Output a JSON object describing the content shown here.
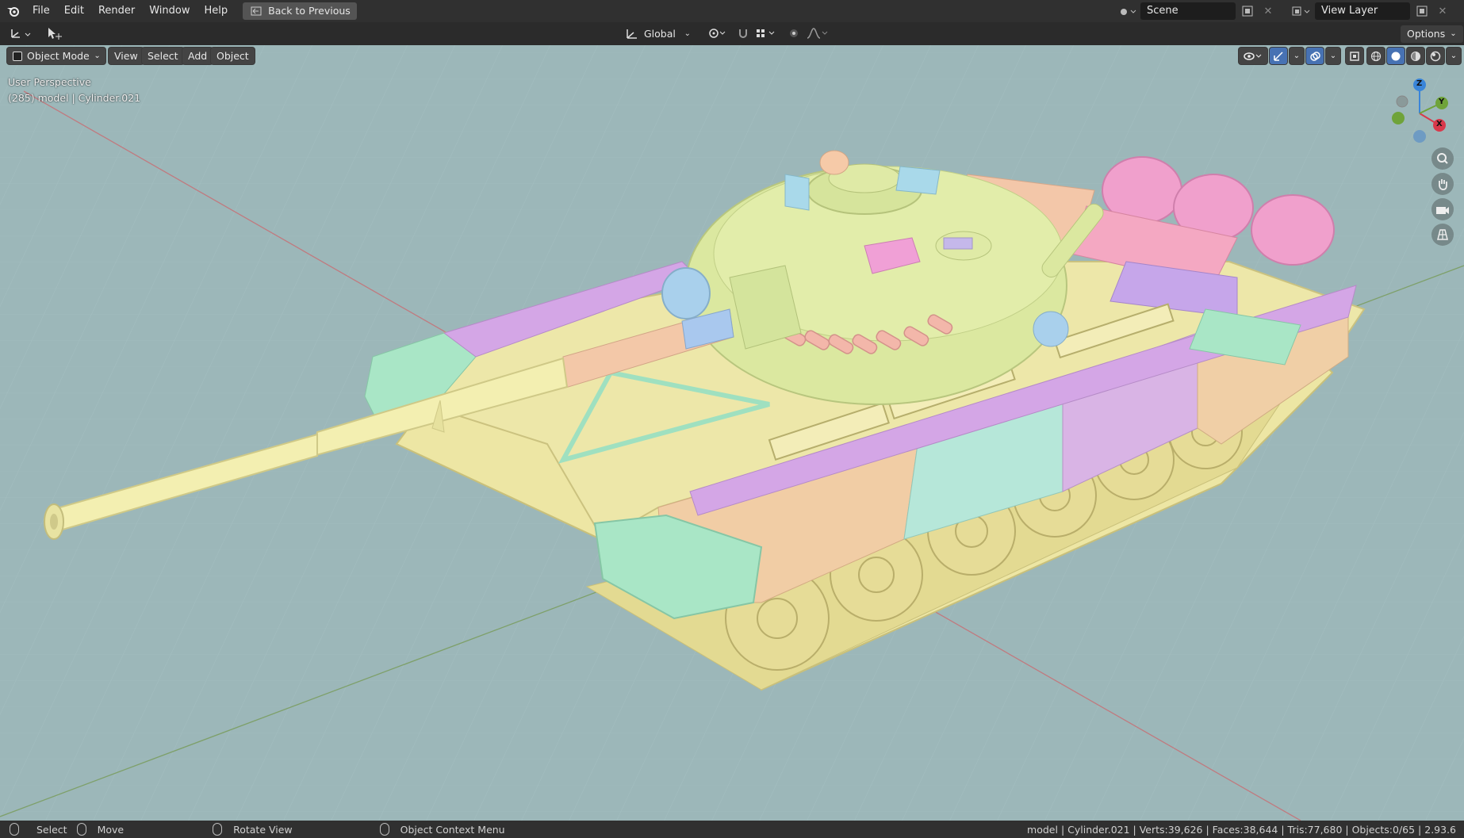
{
  "topbar": {
    "menus": [
      "File",
      "Edit",
      "Render",
      "Window",
      "Help"
    ],
    "back_button": "Back to Previous",
    "scene_label": "Scene",
    "view_layer_label": "View Layer"
  },
  "header": {
    "transform_orientation": "Global",
    "options_label": "Options"
  },
  "viewport_header": {
    "mode": "Object Mode",
    "menus": [
      "View",
      "Select",
      "Add",
      "Object"
    ]
  },
  "viewport": {
    "perspective_label": "User Perspective",
    "object_label": "(285) model | Cylinder.021",
    "gizmo_axes": {
      "x": "X",
      "y": "Y",
      "z": "Z"
    },
    "background_color": "#9cb7b9"
  },
  "statusbar": {
    "select": "Select",
    "move": "Move",
    "rotate_view": "Rotate View",
    "context_menu": "Object Context Menu",
    "stats": "model | Cylinder.021 | Verts:39,626 | Faces:38,644 | Tris:77,680 | Objects:0/65 | 2.93.6"
  },
  "colors": {
    "accent_blue": "#4772b3",
    "axis_x": "#d9384b",
    "axis_y": "#6fa33a",
    "axis_z": "#3a85d9"
  }
}
